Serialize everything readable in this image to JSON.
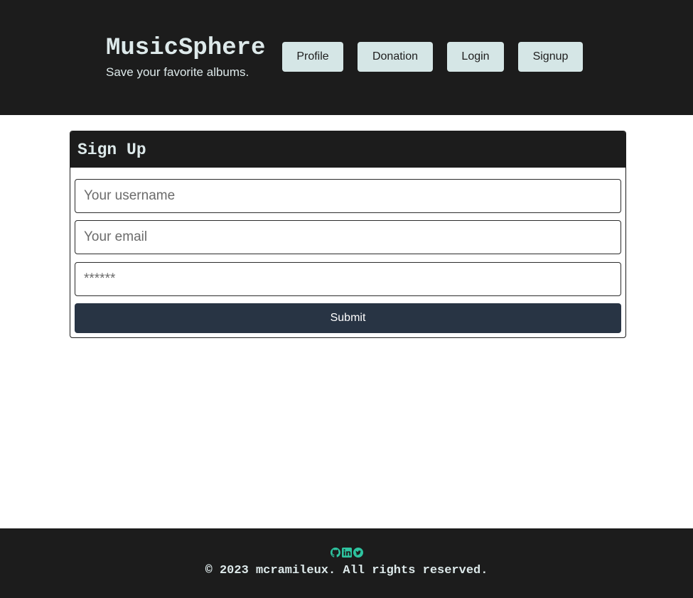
{
  "header": {
    "title": "MusicSphere",
    "tagline": "Save your favorite albums.",
    "nav": {
      "profile": "Profile",
      "donation": "Donation",
      "login": "Login",
      "signup": "Signup"
    }
  },
  "signup_form": {
    "title": "Sign Up",
    "username_placeholder": "Your username",
    "email_placeholder": "Your email",
    "password_placeholder": "******",
    "submit_label": "Submit"
  },
  "footer": {
    "social_icons": [
      "github-icon",
      "linkedin-icon",
      "twitter-icon"
    ],
    "icon_color": "#2ec4a0",
    "copyright": "© 2023 mcramileux. All rights reserved."
  },
  "colors": {
    "header_bg": "#1c1c1c",
    "nav_button_bg": "#d5e6e6",
    "submit_bg": "#283444",
    "text_light": "#dde9ea"
  }
}
